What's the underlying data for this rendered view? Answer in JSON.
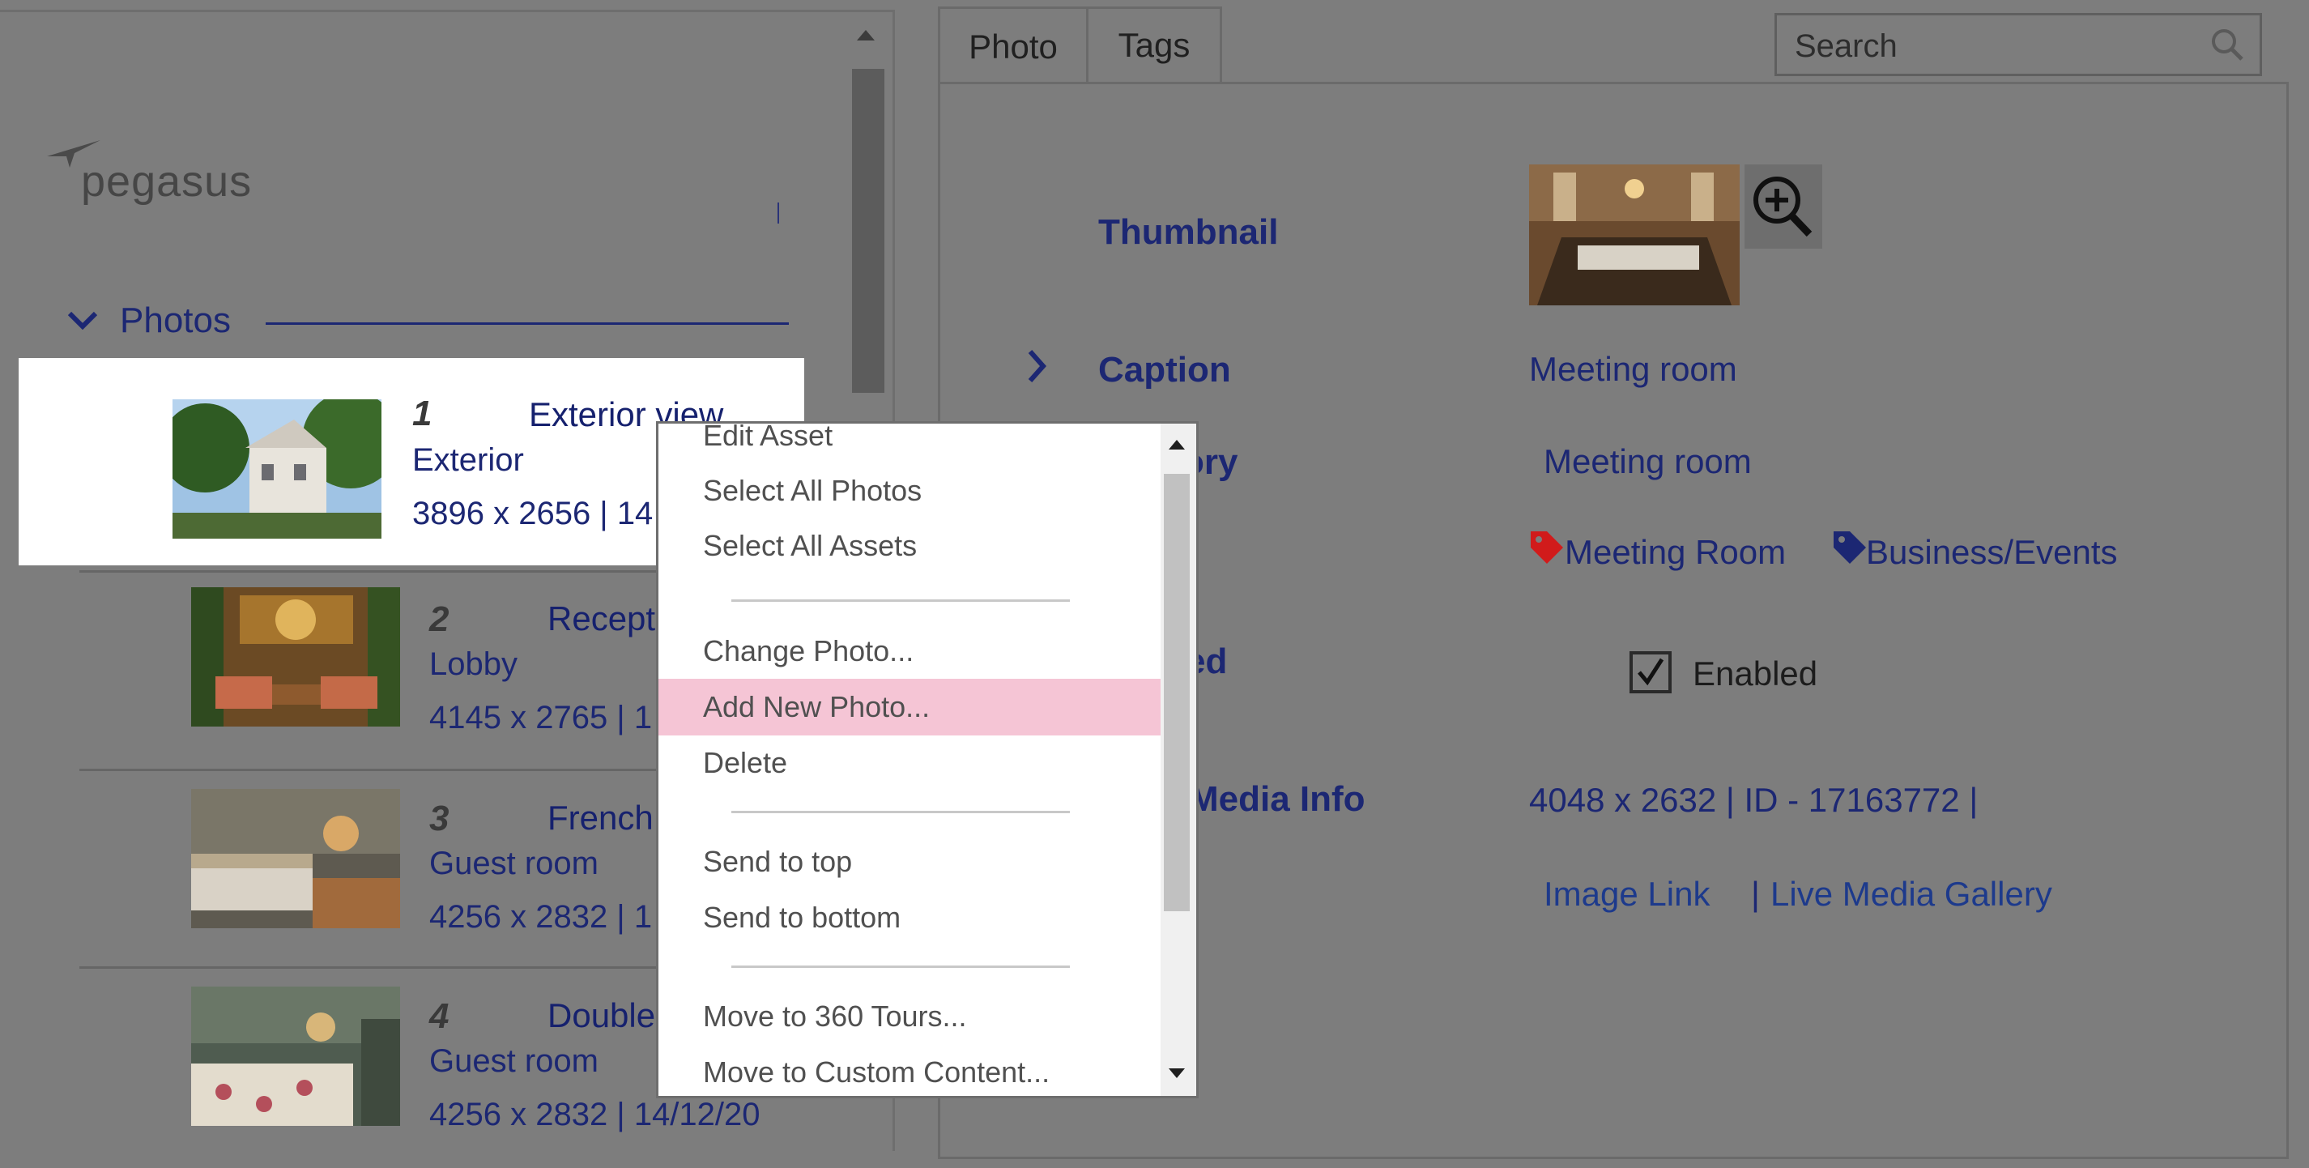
{
  "brand": {
    "name": "pegasus"
  },
  "photos_section": {
    "title": "Photos"
  },
  "photos": [
    {
      "num": "1",
      "title": "Exterior view",
      "category": "Exterior",
      "meta": "3896 x 2656 | 14"
    },
    {
      "num": "2",
      "title": "Recept",
      "category": "Lobby",
      "meta": "4145 x 2765 | 1"
    },
    {
      "num": "3",
      "title": "French",
      "category": "Guest room",
      "meta": "4256 x 2832 | 1"
    },
    {
      "num": "4",
      "title": "Double",
      "category": "Guest room",
      "meta": "4256 x 2832 | 14/12/20"
    }
  ],
  "tabs": [
    {
      "label": "Photo"
    },
    {
      "label": "Tags"
    }
  ],
  "search": {
    "placeholder": "Search"
  },
  "details": {
    "thumbnail_label": "Thumbnail",
    "caption_label": "Caption",
    "caption_value": "Meeting room",
    "category_label_visible": "ory",
    "category_value": "Meeting room",
    "tags": [
      {
        "label": "Meeting Room",
        "color": "#d11b1b"
      },
      {
        "label": "Business/Events",
        "color": "#1c2773"
      }
    ],
    "enabled_label_visible": "ed",
    "enabled_text": "Enabled",
    "media_info_label_visible": "Media Info",
    "media_info_value": "4048 x 2632 | ID - 17163772 |",
    "image_link": "Image Link",
    "separator": "|",
    "live_media_gallery": "Live Media Gallery"
  },
  "context_menu": {
    "items": [
      {
        "label": "Edit Asset"
      },
      {
        "label": "Select All Photos"
      },
      {
        "label": "Select All Assets"
      },
      {
        "label": "Change Photo..."
      },
      {
        "label": "Add New Photo..."
      },
      {
        "label": "Delete"
      },
      {
        "label": "Send to top"
      },
      {
        "label": "Send to bottom"
      },
      {
        "label": "Move to 360 Tours..."
      },
      {
        "label": "Move to Custom Content..."
      }
    ],
    "active_index": 4
  },
  "colors": {
    "overlay": "#7d7d7d",
    "accent": "#1c2773",
    "menu_highlight": "#f5c5d5"
  }
}
